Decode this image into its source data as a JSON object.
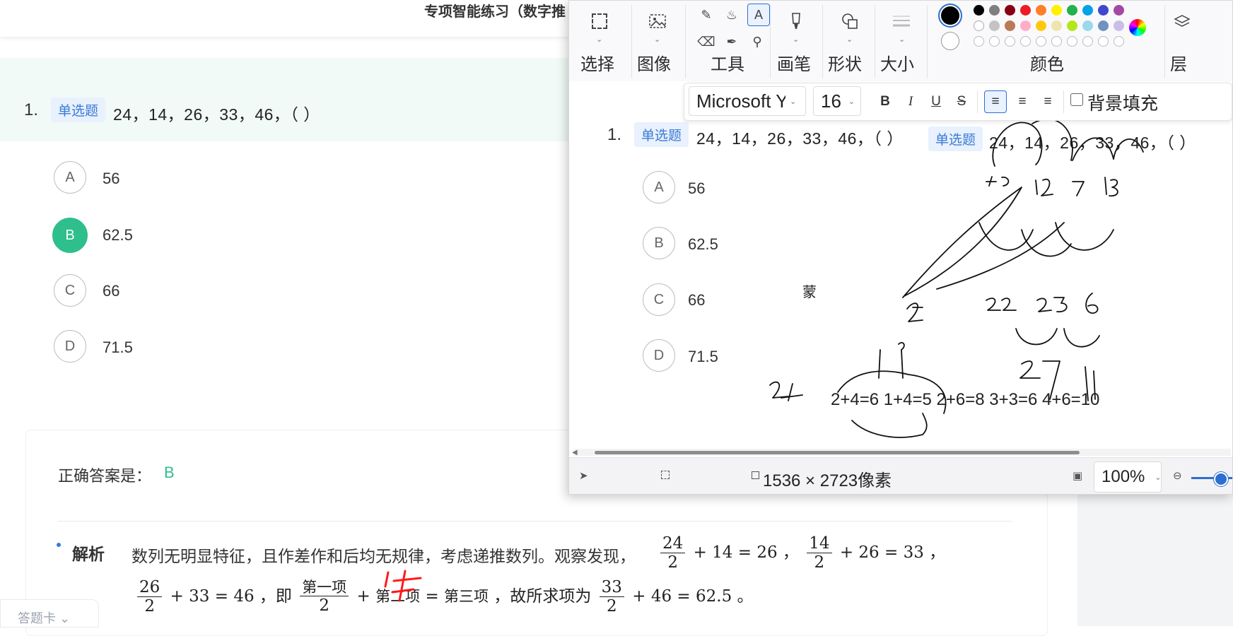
{
  "page": {
    "title": "专项智能练习（数字推",
    "question": {
      "number": "1.",
      "type_tag": "单选题",
      "text": "24，14，26，33，46，（ ）"
    },
    "options": [
      {
        "letter": "A",
        "value": "56",
        "selected": false
      },
      {
        "letter": "B",
        "value": "62.5",
        "selected": true
      },
      {
        "letter": "C",
        "value": "66",
        "selected": false
      },
      {
        "letter": "D",
        "value": "71.5",
        "selected": false
      }
    ],
    "answer": {
      "label": "正确答案是：",
      "value": "B"
    },
    "analysis": {
      "title": "解析",
      "text": "数列无明显特征，且作差作和后均无规律，考虑递推数列。观察发现，",
      "sep1": "，",
      "sep2": "，",
      "ie": "，即",
      "conclusion": "，故所求项为",
      "end": "。",
      "terms": {
        "first": "第一项",
        "second": "第二项",
        "third": "第三项"
      },
      "eq1": {
        "num": "24",
        "den": "2",
        "rest": "+ 14 = 26"
      },
      "eq2": {
        "num": "14",
        "den": "2",
        "rest": "+ 26 = 33"
      },
      "eq3": {
        "num": "26",
        "den": "2",
        "rest": "+ 33 = 46"
      },
      "eq4": {
        "den": "2",
        "plus": "+",
        "equals": "="
      },
      "eq5": {
        "num": "33",
        "den": "2",
        "rest": "+ 46 = 62.5"
      },
      "annotation": "1+"
    },
    "answer_card_tab": "答题卡"
  },
  "paint": {
    "ribbon": {
      "groups": [
        {
          "label": "选择",
          "icon": "select-rect-icon"
        },
        {
          "label": "图像",
          "icon": "image-icon"
        },
        {
          "label": "工具",
          "icon": "tools-icon"
        },
        {
          "label": "画笔",
          "icon": "brush-icon"
        },
        {
          "label": "形状",
          "icon": "shapes-icon"
        },
        {
          "label": "大小",
          "icon": "size-icon"
        },
        {
          "label": "颜色",
          "icon": "palette-icon"
        },
        {
          "label": "层",
          "icon": "layers-icon"
        }
      ],
      "colors": {
        "primary": "#000000",
        "secondary": "#ffffff",
        "row1": [
          "#000000",
          "#7f7f7f",
          "#880015",
          "#ed1c24",
          "#ff7f27",
          "#fff200",
          "#22b14c",
          "#00a2e8",
          "#3f48cc",
          "#a349a4"
        ],
        "row2": [
          "#ffffff",
          "#c3c3c3",
          "#b97a57",
          "#ffaec9",
          "#ffc90e",
          "#efe4b0",
          "#b5e61d",
          "#99d9ea",
          "#7092be",
          "#c8bfe7"
        ]
      }
    },
    "text_toolbar": {
      "font": "Microsoft Ya",
      "size": "16",
      "bold": "B",
      "italic": "I",
      "underline": "U",
      "strike": "S",
      "fill_label": "背景填充"
    },
    "canvas": {
      "question_number": "1.",
      "type_tag": "单选题",
      "question_text": "24，14，26，33，46，（ ）",
      "dup_tag": "单选题",
      "dup_text": "24，14，26，33，46，（ ）",
      "options": [
        {
          "letter": "A",
          "value": "56"
        },
        {
          "letter": "B",
          "value": "62.5"
        },
        {
          "letter": "C",
          "value": "66"
        },
        {
          "letter": "D",
          "value": "71.5"
        }
      ],
      "stray_char": "蒙",
      "typed_line": "2+4=6 1+4=5 2+6=8 3+3=6 4+6=10"
    },
    "status": {
      "dimensions": "1536 × 2723像素",
      "zoom": "100%"
    }
  }
}
